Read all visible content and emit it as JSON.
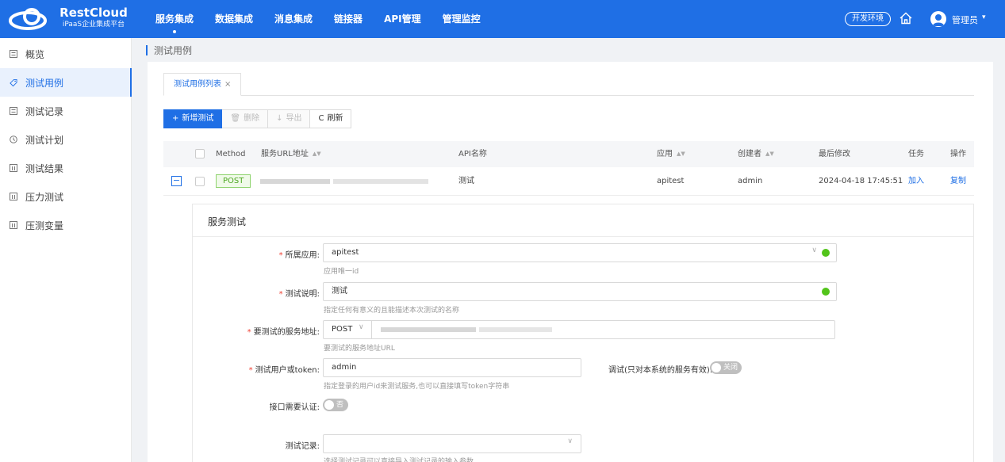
{
  "brand": {
    "name": "RestCloud",
    "subtitle": "iPaaS企业集成平台"
  },
  "nav": {
    "items": [
      {
        "label": "服务集成",
        "active": true
      },
      {
        "label": "数据集成"
      },
      {
        "label": "消息集成"
      },
      {
        "label": "链接器"
      },
      {
        "label": "API管理"
      },
      {
        "label": "管理监控"
      }
    ],
    "env_label": "开发环境",
    "user_name": "管理员",
    "user_caret": "▾"
  },
  "sidebar": {
    "items": [
      {
        "label": "概览",
        "icon": "overview-icon"
      },
      {
        "label": "测试用例",
        "icon": "tag-icon",
        "active": true
      },
      {
        "label": "测试记录",
        "icon": "record-icon"
      },
      {
        "label": "测试计划",
        "icon": "clock-icon"
      },
      {
        "label": "测试结果",
        "icon": "result-icon"
      },
      {
        "label": "压力测试",
        "icon": "stress-icon"
      },
      {
        "label": "压测变量",
        "icon": "variable-icon"
      }
    ]
  },
  "breadcrumb": {
    "text": "测试用例"
  },
  "tab": {
    "label": "测试用例列表",
    "close": "×"
  },
  "toolbar": {
    "new_label": "新增测试",
    "new_icon": "+",
    "delete_label": "删除",
    "delete_icon": "🗑",
    "export_label": "导出",
    "export_icon": "↓",
    "refresh_label": "刷新",
    "refresh_icon": "C"
  },
  "table": {
    "headers": {
      "method": "Method",
      "url": "服务URL地址",
      "api_name": "API名称",
      "app": "应用",
      "creator": "创建者",
      "modified": "最后修改",
      "task": "任务",
      "action": "操作"
    },
    "sort_icon": "▲▼",
    "row": {
      "expand": "−",
      "method": "POST",
      "api_name": "测试",
      "app": "apitest",
      "creator": "admin",
      "modified": "2024-04-18 17:45:51",
      "task": "加入",
      "action": "复制"
    }
  },
  "form": {
    "title": "服务测试",
    "app": {
      "label": "所属应用:",
      "value": "apitest",
      "hint": "应用唯一id"
    },
    "desc": {
      "label": "测试说明:",
      "value": "测试",
      "hint": "指定任何有意义的且能描述本次测试的名称"
    },
    "service": {
      "label": "要测试的服务地址:",
      "method": "POST",
      "hint": "要测试的服务地址URL"
    },
    "token": {
      "label": "测试用户或token:",
      "value": "admin",
      "hint": "指定登录的用户id来测试服务,也可以直接填写token字符串"
    },
    "debug": {
      "label": "调试(只对本系统的服务有效):",
      "toggle": "关闭"
    },
    "auth": {
      "label": "接口需要认证:",
      "toggle": "否"
    },
    "record": {
      "label": "测试记录:",
      "placeholder": "",
      "hint": "选择测试记录可以直接导入测试记录的输入参数"
    },
    "chevron": "∨"
  },
  "colors": {
    "primary": "#1f6fe5",
    "success": "#52c41a",
    "post_tag": "#4ea823",
    "required": "#f04134"
  }
}
